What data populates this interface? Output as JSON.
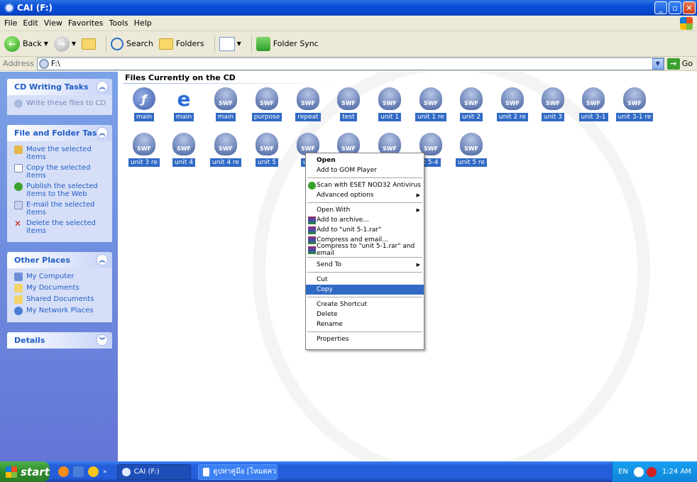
{
  "window": {
    "title": "CAI (F:)"
  },
  "menubar": [
    "File",
    "Edit",
    "View",
    "Favorites",
    "Tools",
    "Help"
  ],
  "toolbar": {
    "back": "Back",
    "search": "Search",
    "folders": "Folders",
    "folder_sync": "Folder Sync"
  },
  "address": {
    "label": "Address",
    "value": "F:\\",
    "go": "Go"
  },
  "left_pane": {
    "cd_tasks": {
      "title": "CD Writing Tasks",
      "items": [
        "Write these files to CD"
      ]
    },
    "file_tasks": {
      "title": "File and Folder Tasks",
      "items": [
        "Move the selected items",
        "Copy the selected items",
        "Publish the selected items to the Web",
        "E-mail the selected items",
        "Delete the selected items"
      ]
    },
    "other_places": {
      "title": "Other Places",
      "items": [
        "My Computer",
        "My Documents",
        "Shared Documents",
        "My Network Places"
      ]
    },
    "details": {
      "title": "Details"
    }
  },
  "main": {
    "heading": "Files Currently on the CD",
    "files_row1": [
      "main",
      "main",
      "main",
      "purpose",
      "repeat",
      "test",
      "unit 1",
      "unit 1 re",
      "unit 2",
      "unit 2 re",
      "unit 3",
      "unit 3-1",
      "unit 3-1 re"
    ],
    "files_row2": [
      "unit 3 re",
      "unit 4",
      "unit 4 re",
      "unit 5",
      "uni",
      "",
      "",
      "t 5-4",
      "unit 5 re"
    ]
  },
  "context_menu": {
    "open": "Open",
    "add_gom": "Add to GOM Player",
    "scan": "Scan with ESET NOD32 Antivirus",
    "advanced": "Advanced options",
    "open_with": "Open With",
    "add_archive": "Add to archive...",
    "add_rar": "Add to \"unit 5-1.rar\"",
    "compress_email": "Compress and email...",
    "compress_rar_email": "Compress to \"unit 5-1.rar\" and email",
    "send_to": "Send To",
    "cut": "Cut",
    "copy": "Copy",
    "create_shortcut": "Create Shortcut",
    "delete": "Delete",
    "rename": "Rename",
    "properties": "Properties"
  },
  "taskbar": {
    "start": "start",
    "task1": "CAI (F:)",
    "task2": "ดูปท่าคู่มือ [โหมดความ...",
    "lang": "EN",
    "time": "1:24 AM"
  }
}
